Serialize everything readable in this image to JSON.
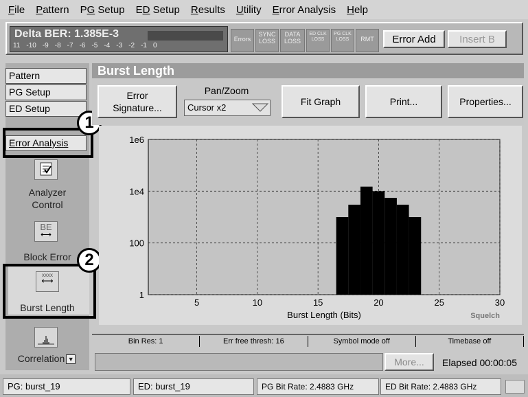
{
  "menu": {
    "items": [
      {
        "label": "File",
        "accel": "F",
        "rest": "ile"
      },
      {
        "label": "Pattern",
        "accel": "P",
        "rest": "attern"
      },
      {
        "label": "PG Setup",
        "pre": "P",
        "accel": "G",
        "rest": " Setup"
      },
      {
        "label": "ED Setup",
        "pre": "E",
        "accel": "D",
        "rest": " Setup"
      },
      {
        "label": "Results",
        "accel": "R",
        "rest": "esults"
      },
      {
        "label": "Utility",
        "accel": "U",
        "rest": "tility"
      },
      {
        "label": "Error Analysis",
        "accel": "E",
        "rest": "rror Analysis"
      },
      {
        "label": "Help",
        "accel": "H",
        "rest": "elp"
      }
    ]
  },
  "ber": {
    "title": "Delta BER: 1.385E-3",
    "scale": [
      "11",
      "-10",
      "-9",
      "-8",
      "-7",
      "-6",
      "-5",
      "-4",
      "-3",
      "-2",
      "-1",
      "0"
    ]
  },
  "indicators": [
    {
      "l1": "Errors",
      "l2": ""
    },
    {
      "l1": "SYNC",
      "l2": "LOSS"
    },
    {
      "l1": "DATA",
      "l2": "LOSS"
    },
    {
      "l1": "ED CLK",
      "l2": "LOSS"
    },
    {
      "l1": "PG CLK",
      "l2": "LOSS"
    },
    {
      "l1": "RMT",
      "l2": ""
    }
  ],
  "top_buttons": {
    "error_add": "Error Add",
    "insert": "Insert B"
  },
  "sidebar": {
    "tabs": [
      "Pattern",
      "PG Setup",
      "ED Setup",
      "Error Analysis"
    ],
    "tools": [
      {
        "label1": "Analyzer",
        "label2": "Control"
      },
      {
        "label1": "Block Error",
        "label2": ""
      },
      {
        "label1": "Burst Length",
        "label2": ""
      },
      {
        "label1": "Correlation",
        "label2": ""
      }
    ],
    "block_error_icon_text": "BE",
    "burst_icon_text": "xxxx"
  },
  "panel": {
    "title": "Burst Length"
  },
  "toolbar": {
    "error_signature_1": "Error",
    "error_signature_2": "Signature...",
    "panzoom_label": "Pan/Zoom",
    "panzoom_value": "Cursor x2",
    "fit_graph": "Fit Graph",
    "print": "Print...",
    "properties": "Properties..."
  },
  "chart_data": {
    "type": "bar",
    "xlabel": "Burst Length (Bits)",
    "ylabel": "",
    "x_ticks": [
      5,
      10,
      15,
      20,
      25,
      30
    ],
    "y_ticks": [
      "1",
      "100",
      "1e4",
      "1e6"
    ],
    "xlim": [
      1,
      30
    ],
    "ylim": [
      1,
      1000000
    ],
    "y_scale": "log",
    "grid": true,
    "annotation": "Squelch",
    "categories": [
      17,
      18,
      19,
      20,
      21,
      22,
      23
    ],
    "values": [
      1000,
      3000,
      15000,
      10000,
      5500,
      3000,
      1000
    ]
  },
  "status": [
    "Bin Res: 1",
    "Err free thresh: 16",
    "Symbol mode off",
    "Timebase off"
  ],
  "more": "More...",
  "elapsed": "Elapsed 00:00:05",
  "footer": {
    "pg": "PG: burst_19",
    "ed": "ED: burst_19",
    "pg_rate": "PG Bit Rate: 2.4883 GHz",
    "ed_rate": "ED Bit Rate: 2.4883 GHz"
  },
  "callouts": [
    "1",
    "2"
  ]
}
